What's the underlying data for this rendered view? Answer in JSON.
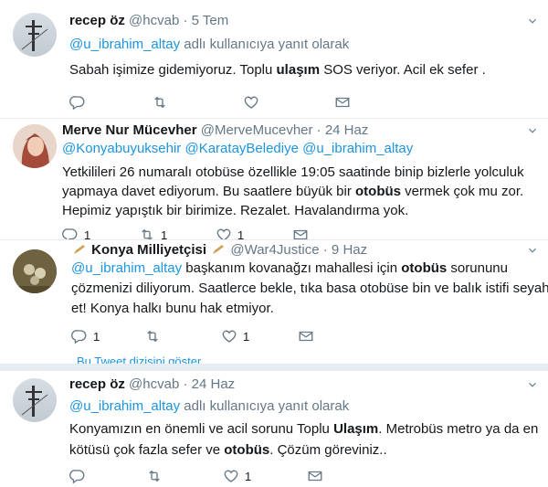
{
  "tweets": [
    {
      "name": "recep öz",
      "handle": "@hcvab",
      "date": "· 5 Tem",
      "reply_context_user": "@u_ibrahim_altay",
      "reply_context_text": " adlı kullanıcıya yanıt olarak",
      "text_line1_a": "Sabah işimize gidemiyoruz. Toplu ",
      "text_line1_b": "ulaşım",
      "text_line1_c": " SOS veriyor. Acil ek sefer .",
      "reply_count": "",
      "retweet_count": "",
      "like_count": ""
    },
    {
      "name": "Merve Nur Mücevher",
      "handle": "@MerveMucevher",
      "date": "· 24 Haz",
      "mentions": [
        "@Konyabuyuksehir",
        "@KaratayBelediye",
        "@u_ibrahim_altay"
      ],
      "text_line1": "Yetkilileri 26 numaralı otobüse özellikle 19:05 saatinde binip bizlerle yolculuk",
      "text_line2_a": "yapmaya davet ediyorum. Bu saatlere büyük bir ",
      "text_line2_b": "otobüs",
      "text_line2_c": " vermek çok mu zor.",
      "text_line3": "Hepimiz yapıştık bir birimize. Rezalet. Havalandırma yok.",
      "reply_count": "1",
      "retweet_count": "1",
      "like_count": "1"
    },
    {
      "name": "Konya Milliyetçisi",
      "handle": "@War4Justice",
      "date": "· 9 Haz",
      "mention": "@u_ibrahim_altay",
      "text_line1_a": " başkanım kovanağzı mahallesi için ",
      "text_line1_b": "otobüs",
      "text_line1_c": " sorununu",
      "text_line2": "çözmenizi diliyorum. Saatlerce bekle, tıka basa otobüse bin ve balık istifi seyahat",
      "text_line3": "et! Konya halkı bunu hak etmiyor.",
      "reply_count": "1",
      "retweet_count": "",
      "like_count": "1",
      "show_thread": "Bu Tweet dizisini göster"
    },
    {
      "name": "recep öz",
      "handle": "@hcvab",
      "date": "· 24 Haz",
      "reply_context_user": "@u_ibrahim_altay",
      "reply_context_text": " adlı kullanıcıya yanıt olarak",
      "text_line1_a": "Konyamızın en önemli ve acil sorunu Toplu ",
      "text_line1_b": "Ulaşım",
      "text_line1_c": ". Metrobüs metro ya da en",
      "text_line2_a": "kötüsü çok fazla sefer ve ",
      "text_line2_b": "otobüs",
      "text_line2_c": ". Çözüm göreviniz..",
      "reply_count": "",
      "retweet_count": "",
      "like_count": "1"
    }
  ],
  "colors": {
    "link": "#1b95e0",
    "muted": "#657786",
    "text": "#14171a",
    "separator": "#e6ecf0"
  }
}
